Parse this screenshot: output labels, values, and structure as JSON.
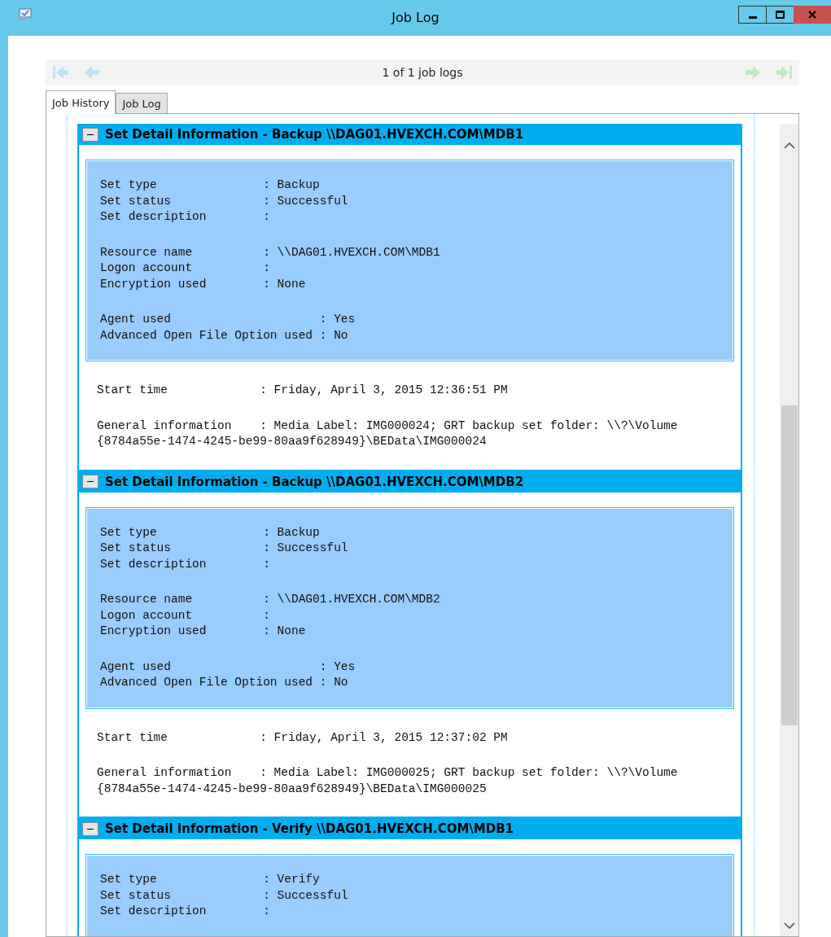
{
  "window": {
    "title": "Job Log"
  },
  "navigator": {
    "position": "1 of 1 job logs"
  },
  "tabs": [
    {
      "label": "Job History",
      "selected": true
    },
    {
      "label": "Job Log",
      "selected": false
    }
  ],
  "sections": [
    {
      "title": "Set Detail Information - Backup \\\\DAG01.HVEXCH.COM\\MDB1",
      "expanded": true,
      "groups": [
        [
          "Set type               : Backup",
          "Set status             : Successful",
          "Set description        :"
        ],
        [
          "Resource name          : \\\\DAG01.HVEXCH.COM\\MDB1",
          "Logon account          :",
          "Encryption used        : None"
        ],
        [
          "Agent used                     : Yes",
          "Advanced Open File Option used : No"
        ]
      ],
      "start_time": "Start time             : Friday, April 3, 2015 12:36:51 PM",
      "general_info": [
        "General information    : Media Label: IMG000024; GRT backup set folder: \\\\?\\Volume",
        "{8784a55e-1474-4245-be99-80aa9f628949}\\BEData\\IMG000024"
      ]
    },
    {
      "title": "Set Detail Information - Backup \\\\DAG01.HVEXCH.COM\\MDB2",
      "expanded": true,
      "groups": [
        [
          "Set type               : Backup",
          "Set status             : Successful",
          "Set description        :"
        ],
        [
          "Resource name          : \\\\DAG01.HVEXCH.COM\\MDB2",
          "Logon account          :",
          "Encryption used        : None"
        ],
        [
          "Agent used                     : Yes",
          "Advanced Open File Option used : No"
        ]
      ],
      "start_time": "Start time             : Friday, April 3, 2015 12:37:02 PM",
      "general_info": [
        "General information    : Media Label: IMG000025; GRT backup set folder: \\\\?\\Volume",
        "{8784a55e-1474-4245-be99-80aa9f628949}\\BEData\\IMG000025"
      ]
    },
    {
      "title": "Set Detail Information - Verify \\\\DAG01.HVEXCH.COM\\MDB1",
      "expanded": true,
      "groups": [
        [
          "Set type               : Verify",
          "Set status             : Successful",
          "Set description        :"
        ]
      ]
    }
  ]
}
